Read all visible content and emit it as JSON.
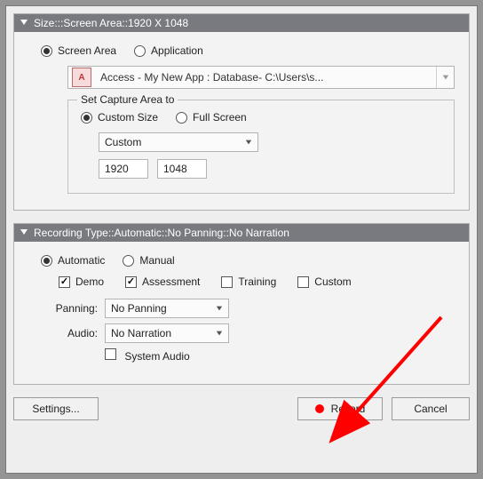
{
  "size_panel": {
    "title": "Size:::Screen Area::1920 X 1048",
    "mode": {
      "screen_area": "Screen Area",
      "application": "Application"
    },
    "app_selected": "Access - My New App : Database- C:\\Users\\s...",
    "app_icon_text": "A",
    "capture_area": {
      "legend": "Set Capture Area to",
      "custom_size": "Custom Size",
      "full_screen": "Full Screen",
      "preset": "Custom",
      "width": "1920",
      "height": "1048"
    }
  },
  "recording_panel": {
    "title": "Recording Type::Automatic::No Panning::No Narration",
    "mode": {
      "automatic": "Automatic",
      "manual": "Manual"
    },
    "flags": {
      "demo": "Demo",
      "assessment": "Assessment",
      "training": "Training",
      "custom": "Custom"
    },
    "panning_label": "Panning:",
    "panning_value": "No Panning",
    "audio_label": "Audio:",
    "audio_value": "No Narration",
    "system_audio": "System Audio"
  },
  "footer": {
    "settings": "Settings...",
    "record": "Record",
    "cancel": "Cancel"
  }
}
